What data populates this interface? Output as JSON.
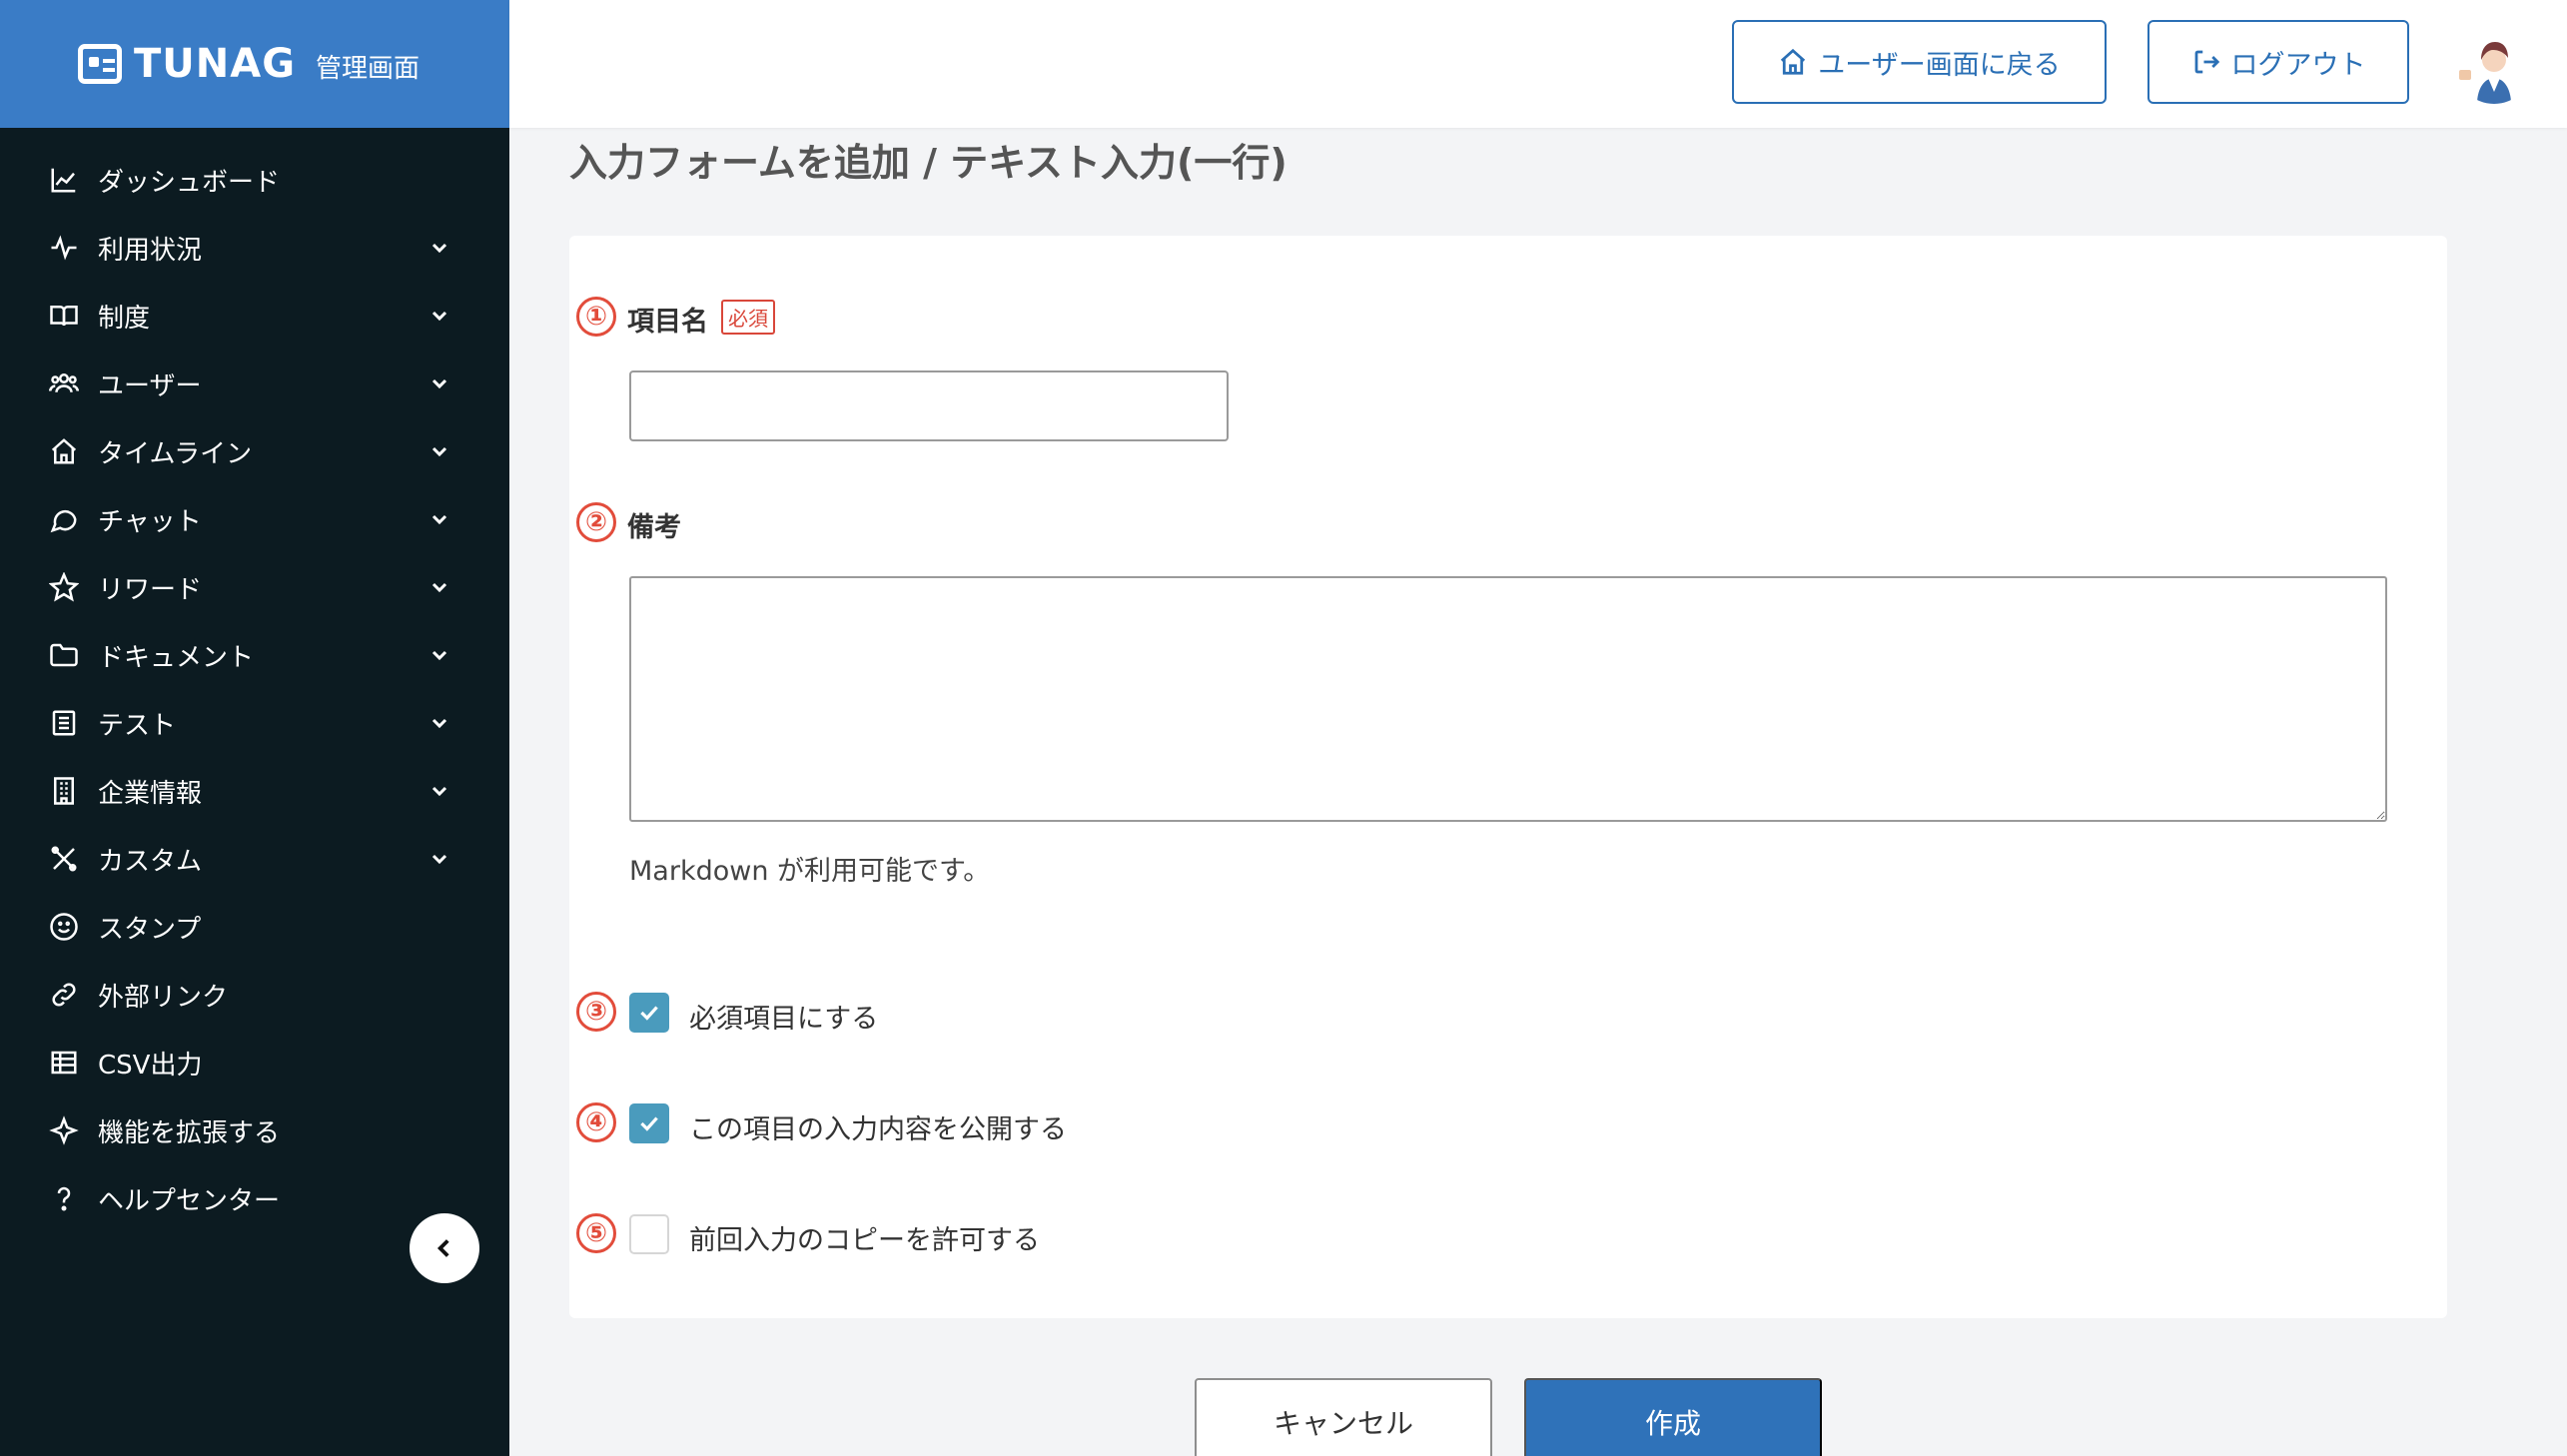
{
  "brand": {
    "logo": "TUNAG",
    "subtitle": "管理画面"
  },
  "header": {
    "user_screen": "ユーザー画面に戻る",
    "logout": "ログアウト"
  },
  "sidebar": {
    "items": [
      {
        "label": "ダッシュボード",
        "icon": "chart-icon",
        "expandable": false
      },
      {
        "label": "利用状況",
        "icon": "pulse-icon",
        "expandable": true
      },
      {
        "label": "制度",
        "icon": "book-icon",
        "expandable": true
      },
      {
        "label": "ユーザー",
        "icon": "users-icon",
        "expandable": true
      },
      {
        "label": "タイムライン",
        "icon": "home-icon",
        "expandable": true
      },
      {
        "label": "チャット",
        "icon": "chat-icon",
        "expandable": true
      },
      {
        "label": "リワード",
        "icon": "star-icon",
        "expandable": true
      },
      {
        "label": "ドキュメント",
        "icon": "folder-icon",
        "expandable": true
      },
      {
        "label": "テスト",
        "icon": "checklist-icon",
        "expandable": true
      },
      {
        "label": "企業情報",
        "icon": "building-icon",
        "expandable": true
      },
      {
        "label": "カスタム",
        "icon": "tools-icon",
        "expandable": true
      },
      {
        "label": "スタンプ",
        "icon": "smile-icon",
        "expandable": false
      },
      {
        "label": "外部リンク",
        "icon": "link-icon",
        "expandable": false
      },
      {
        "label": "CSV出力",
        "icon": "table-icon",
        "expandable": false
      },
      {
        "label": "機能を拡張する",
        "icon": "sparkle-icon",
        "expandable": false
      },
      {
        "label": "ヘルプセンター",
        "icon": "question-icon",
        "expandable": false
      }
    ]
  },
  "page": {
    "title": "入力フォームを追加 / テキスト入力(一行)"
  },
  "form": {
    "item_name": {
      "num": "①",
      "label": "項目名",
      "required_badge": "必須",
      "value": ""
    },
    "remarks": {
      "num": "②",
      "label": "備考",
      "value": "",
      "help": "Markdown が利用可能です。"
    },
    "checkboxes": [
      {
        "num": "③",
        "label": "必須項目にする",
        "checked": true
      },
      {
        "num": "④",
        "label": "この項目の入力内容を公開する",
        "checked": true
      },
      {
        "num": "⑤",
        "label": "前回入力のコピーを許可する",
        "checked": false
      }
    ]
  },
  "actions": {
    "cancel": "キャンセル",
    "create": "作成"
  },
  "colors": {
    "brand": "#3a7cc6",
    "sidebar": "#0c1b21",
    "accent": "#2f72b9",
    "checkbox": "#4a9bbd",
    "marker": "#e24c3b"
  }
}
